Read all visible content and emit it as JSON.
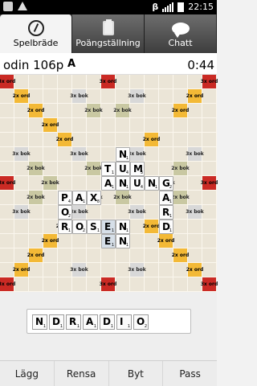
{
  "statusbar": {
    "time": "22:15",
    "network": "β"
  },
  "tabs": [
    {
      "label": "Spelbräde",
      "icon": "compass-icon"
    },
    {
      "label": "Poängställning",
      "icon": "clipboard-icon"
    },
    {
      "label": "Chatt",
      "icon": "chat-bubble-icon"
    }
  ],
  "info": {
    "player": "odin 106p",
    "letter": "A",
    "time": "0:44"
  },
  "board": {
    "size": 15,
    "colors": {
      "3x ord": "#ca2a24",
      "2x ord": "#f3b936",
      "3x bok": "#d8d8d8",
      "2x bok": "#c9c8a2",
      "tile": "#fdfdfd",
      "new_tile": "#d6dfe8"
    },
    "premiums": [
      {
        "r": 0,
        "c": 0,
        "t": "3x ord"
      },
      {
        "r": 0,
        "c": 7,
        "t": "3x ord"
      },
      {
        "r": 0,
        "c": 14,
        "t": "3x ord"
      },
      {
        "r": 1,
        "c": 1,
        "t": "2x ord"
      },
      {
        "r": 1,
        "c": 5,
        "t": "3x bok"
      },
      {
        "r": 1,
        "c": 9,
        "t": "3x bok"
      },
      {
        "r": 1,
        "c": 13,
        "t": "2x ord"
      },
      {
        "r": 2,
        "c": 2,
        "t": "2x ord"
      },
      {
        "r": 2,
        "c": 6,
        "t": "2x bok"
      },
      {
        "r": 2,
        "c": 8,
        "t": "2x bok"
      },
      {
        "r": 2,
        "c": 12,
        "t": "2x ord"
      },
      {
        "r": 3,
        "c": 3,
        "t": "2x ord"
      },
      {
        "r": 4,
        "c": 4,
        "t": "2x ord"
      },
      {
        "r": 4,
        "c": 10,
        "t": "2x ord"
      },
      {
        "r": 5,
        "c": 1,
        "t": "3x bok"
      },
      {
        "r": 5,
        "c": 5,
        "t": "3x bok"
      },
      {
        "r": 5,
        "c": 9,
        "t": "3x bok"
      },
      {
        "r": 5,
        "c": 13,
        "t": "3x bok"
      },
      {
        "r": 6,
        "c": 2,
        "t": "2x bok"
      },
      {
        "r": 6,
        "c": 6,
        "t": "2x bok"
      },
      {
        "r": 6,
        "c": 12,
        "t": "2x bok"
      },
      {
        "r": 7,
        "c": 0,
        "t": "3x ord"
      },
      {
        "r": 7,
        "c": 3,
        "t": "2x bok"
      },
      {
        "r": 7,
        "c": 11,
        "t": "2x bok"
      },
      {
        "r": 7,
        "c": 14,
        "t": "3x ord"
      },
      {
        "r": 8,
        "c": 2,
        "t": "2x bok"
      },
      {
        "r": 8,
        "c": 6,
        "t": "2x bok"
      },
      {
        "r": 8,
        "c": 8,
        "t": "2x bok"
      },
      {
        "r": 8,
        "c": 12,
        "t": "2x bok"
      },
      {
        "r": 9,
        "c": 1,
        "t": "3x bok"
      },
      {
        "r": 9,
        "c": 5,
        "t": "3x bok"
      },
      {
        "r": 9,
        "c": 9,
        "t": "3x bok"
      },
      {
        "r": 9,
        "c": 13,
        "t": "3x bok"
      },
      {
        "r": 10,
        "c": 4,
        "t": "2x ord"
      },
      {
        "r": 10,
        "c": 10,
        "t": "2x ord"
      },
      {
        "r": 11,
        "c": 3,
        "t": "2x ord"
      },
      {
        "r": 11,
        "c": 11,
        "t": "2x ord"
      },
      {
        "r": 12,
        "c": 2,
        "t": "2x ord"
      },
      {
        "r": 12,
        "c": 12,
        "t": "2x ord"
      },
      {
        "r": 13,
        "c": 1,
        "t": "2x ord"
      },
      {
        "r": 13,
        "c": 5,
        "t": "3x bok"
      },
      {
        "r": 13,
        "c": 9,
        "t": "3x bok"
      },
      {
        "r": 13,
        "c": 13,
        "t": "2x ord"
      },
      {
        "r": 14,
        "c": 0,
        "t": "3x ord"
      },
      {
        "r": 14,
        "c": 7,
        "t": "3x ord"
      },
      {
        "r": 14,
        "c": 14,
        "t": "3x ord"
      }
    ],
    "tiles": [
      {
        "r": 5,
        "c": 8,
        "l": "N",
        "s": "1",
        "new": false
      },
      {
        "r": 6,
        "c": 7,
        "l": "T",
        "s": "1",
        "new": false
      },
      {
        "r": 6,
        "c": 8,
        "l": "U",
        "s": "4",
        "new": false
      },
      {
        "r": 6,
        "c": 9,
        "l": "M",
        "s": "3",
        "new": false
      },
      {
        "r": 7,
        "c": 7,
        "l": "A",
        "s": "1",
        "new": false
      },
      {
        "r": 7,
        "c": 8,
        "l": "N",
        "s": "1",
        "new": false
      },
      {
        "r": 7,
        "c": 9,
        "l": "U",
        "s": "4",
        "new": false
      },
      {
        "r": 7,
        "c": 10,
        "l": "N",
        "s": "1",
        "new": false
      },
      {
        "r": 7,
        "c": 11,
        "l": "G",
        "s": "2",
        "new": false
      },
      {
        "r": 8,
        "c": 4,
        "l": "P",
        "s": "4",
        "new": false
      },
      {
        "r": 8,
        "c": 5,
        "l": "A",
        "s": "1",
        "new": false
      },
      {
        "r": 8,
        "c": 6,
        "l": "X",
        "s": "8",
        "new": false
      },
      {
        "r": 8,
        "c": 11,
        "l": "A",
        "s": "1",
        "new": false
      },
      {
        "r": 9,
        "c": 4,
        "l": "O",
        "s": "2",
        "new": false
      },
      {
        "r": 9,
        "c": 11,
        "l": "R",
        "s": "1",
        "new": false
      },
      {
        "r": 10,
        "c": 4,
        "l": "R",
        "s": "1",
        "new": false
      },
      {
        "r": 10,
        "c": 5,
        "l": "O",
        "s": "2",
        "new": false
      },
      {
        "r": 10,
        "c": 6,
        "l": "S",
        "s": "1",
        "new": false
      },
      {
        "r": 10,
        "c": 7,
        "l": "E",
        "s": "1",
        "new": true
      },
      {
        "r": 10,
        "c": 8,
        "l": "N",
        "s": "1",
        "new": false
      },
      {
        "r": 10,
        "c": 11,
        "l": "D",
        "s": "1",
        "new": false
      },
      {
        "r": 11,
        "c": 7,
        "l": "E",
        "s": "1",
        "new": true
      },
      {
        "r": 11,
        "c": 8,
        "l": "N",
        "s": "1",
        "new": false
      }
    ]
  },
  "rack": [
    {
      "l": "N",
      "s": "1"
    },
    {
      "l": "D",
      "s": "1"
    },
    {
      "l": "R",
      "s": "1"
    },
    {
      "l": "A",
      "s": "1"
    },
    {
      "l": "D",
      "s": "1"
    },
    {
      "l": "I",
      "s": "1"
    },
    {
      "l": "O",
      "s": "2"
    }
  ],
  "actions": {
    "place": "Lägg",
    "clear": "Rensa",
    "swap": "Byt",
    "pass": "Pass"
  }
}
